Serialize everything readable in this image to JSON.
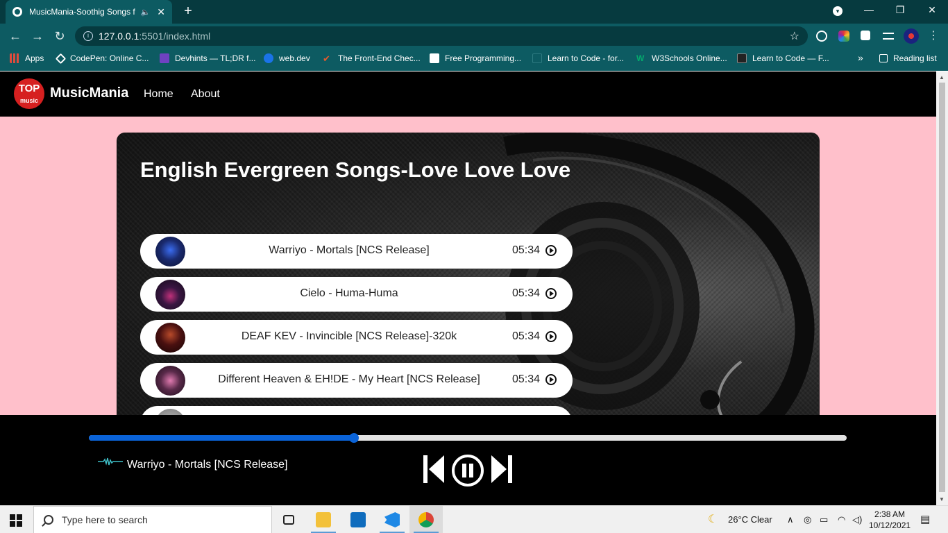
{
  "browser": {
    "tab_title": "MusicMania-Soothig Songs f",
    "tab_speaker": "🔈",
    "tab_close": "✕",
    "new_tab": "+",
    "window_controls": {
      "minimize": "—",
      "restore": "❐",
      "close": "✕"
    },
    "url_host": "127.0.0.1",
    "url_path": ":5501/index.html",
    "bookmarks": [
      {
        "label": "Apps",
        "color": "#e04b3c"
      },
      {
        "label": "CodePen: Online C...",
        "color": "#ffffff"
      },
      {
        "label": "Devhints — TL;DR f...",
        "color": "#6f42c1"
      },
      {
        "label": "web.dev",
        "color": "#1a73e8"
      },
      {
        "label": "The Front-End Chec...",
        "color": "#e85a2c"
      },
      {
        "label": "Free Programming...",
        "color": "#ffffff"
      },
      {
        "label": "Learn to Code - for...",
        "color": "#0d5b62"
      },
      {
        "label": "W3Schools Online...",
        "color": "#04aa6d"
      },
      {
        "label": "Learn to Code — F...",
        "color": "#222222"
      }
    ],
    "bookmarks_more": "»",
    "reading_list": "Reading list"
  },
  "site": {
    "logo_top": "TOP",
    "logo_music": "music",
    "brand": "MusicMania",
    "nav": [
      "Home",
      "About"
    ]
  },
  "hero": {
    "title": "English Evergreen Songs-Love Love Love"
  },
  "songs": [
    {
      "title": "Warriyo - Mortals [NCS Release]",
      "duration": "05:34",
      "cover_color": "#1a2a6e"
    },
    {
      "title": "Cielo - Huma-Huma",
      "duration": "05:34",
      "cover_color": "#3a1642"
    },
    {
      "title": "DEAF KEV - Invincible [NCS Release]-320k",
      "duration": "05:34",
      "cover_color": "#4a1010"
    },
    {
      "title": "Different Heaven & EH!DE - My Heart [NCS Release]",
      "duration": "05:34",
      "cover_color": "#5a2a4a"
    },
    {
      "title": "",
      "duration": "",
      "cover_color": "#888888"
    }
  ],
  "player": {
    "now_playing": "Warriyo - Mortals [NCS Release]",
    "progress": 0.35,
    "accent": "#0a63d8"
  },
  "taskbar": {
    "search_placeholder": "Type here to search",
    "weather": "26°C  Clear",
    "time": "2:38 AM",
    "date": "10/12/2021"
  }
}
